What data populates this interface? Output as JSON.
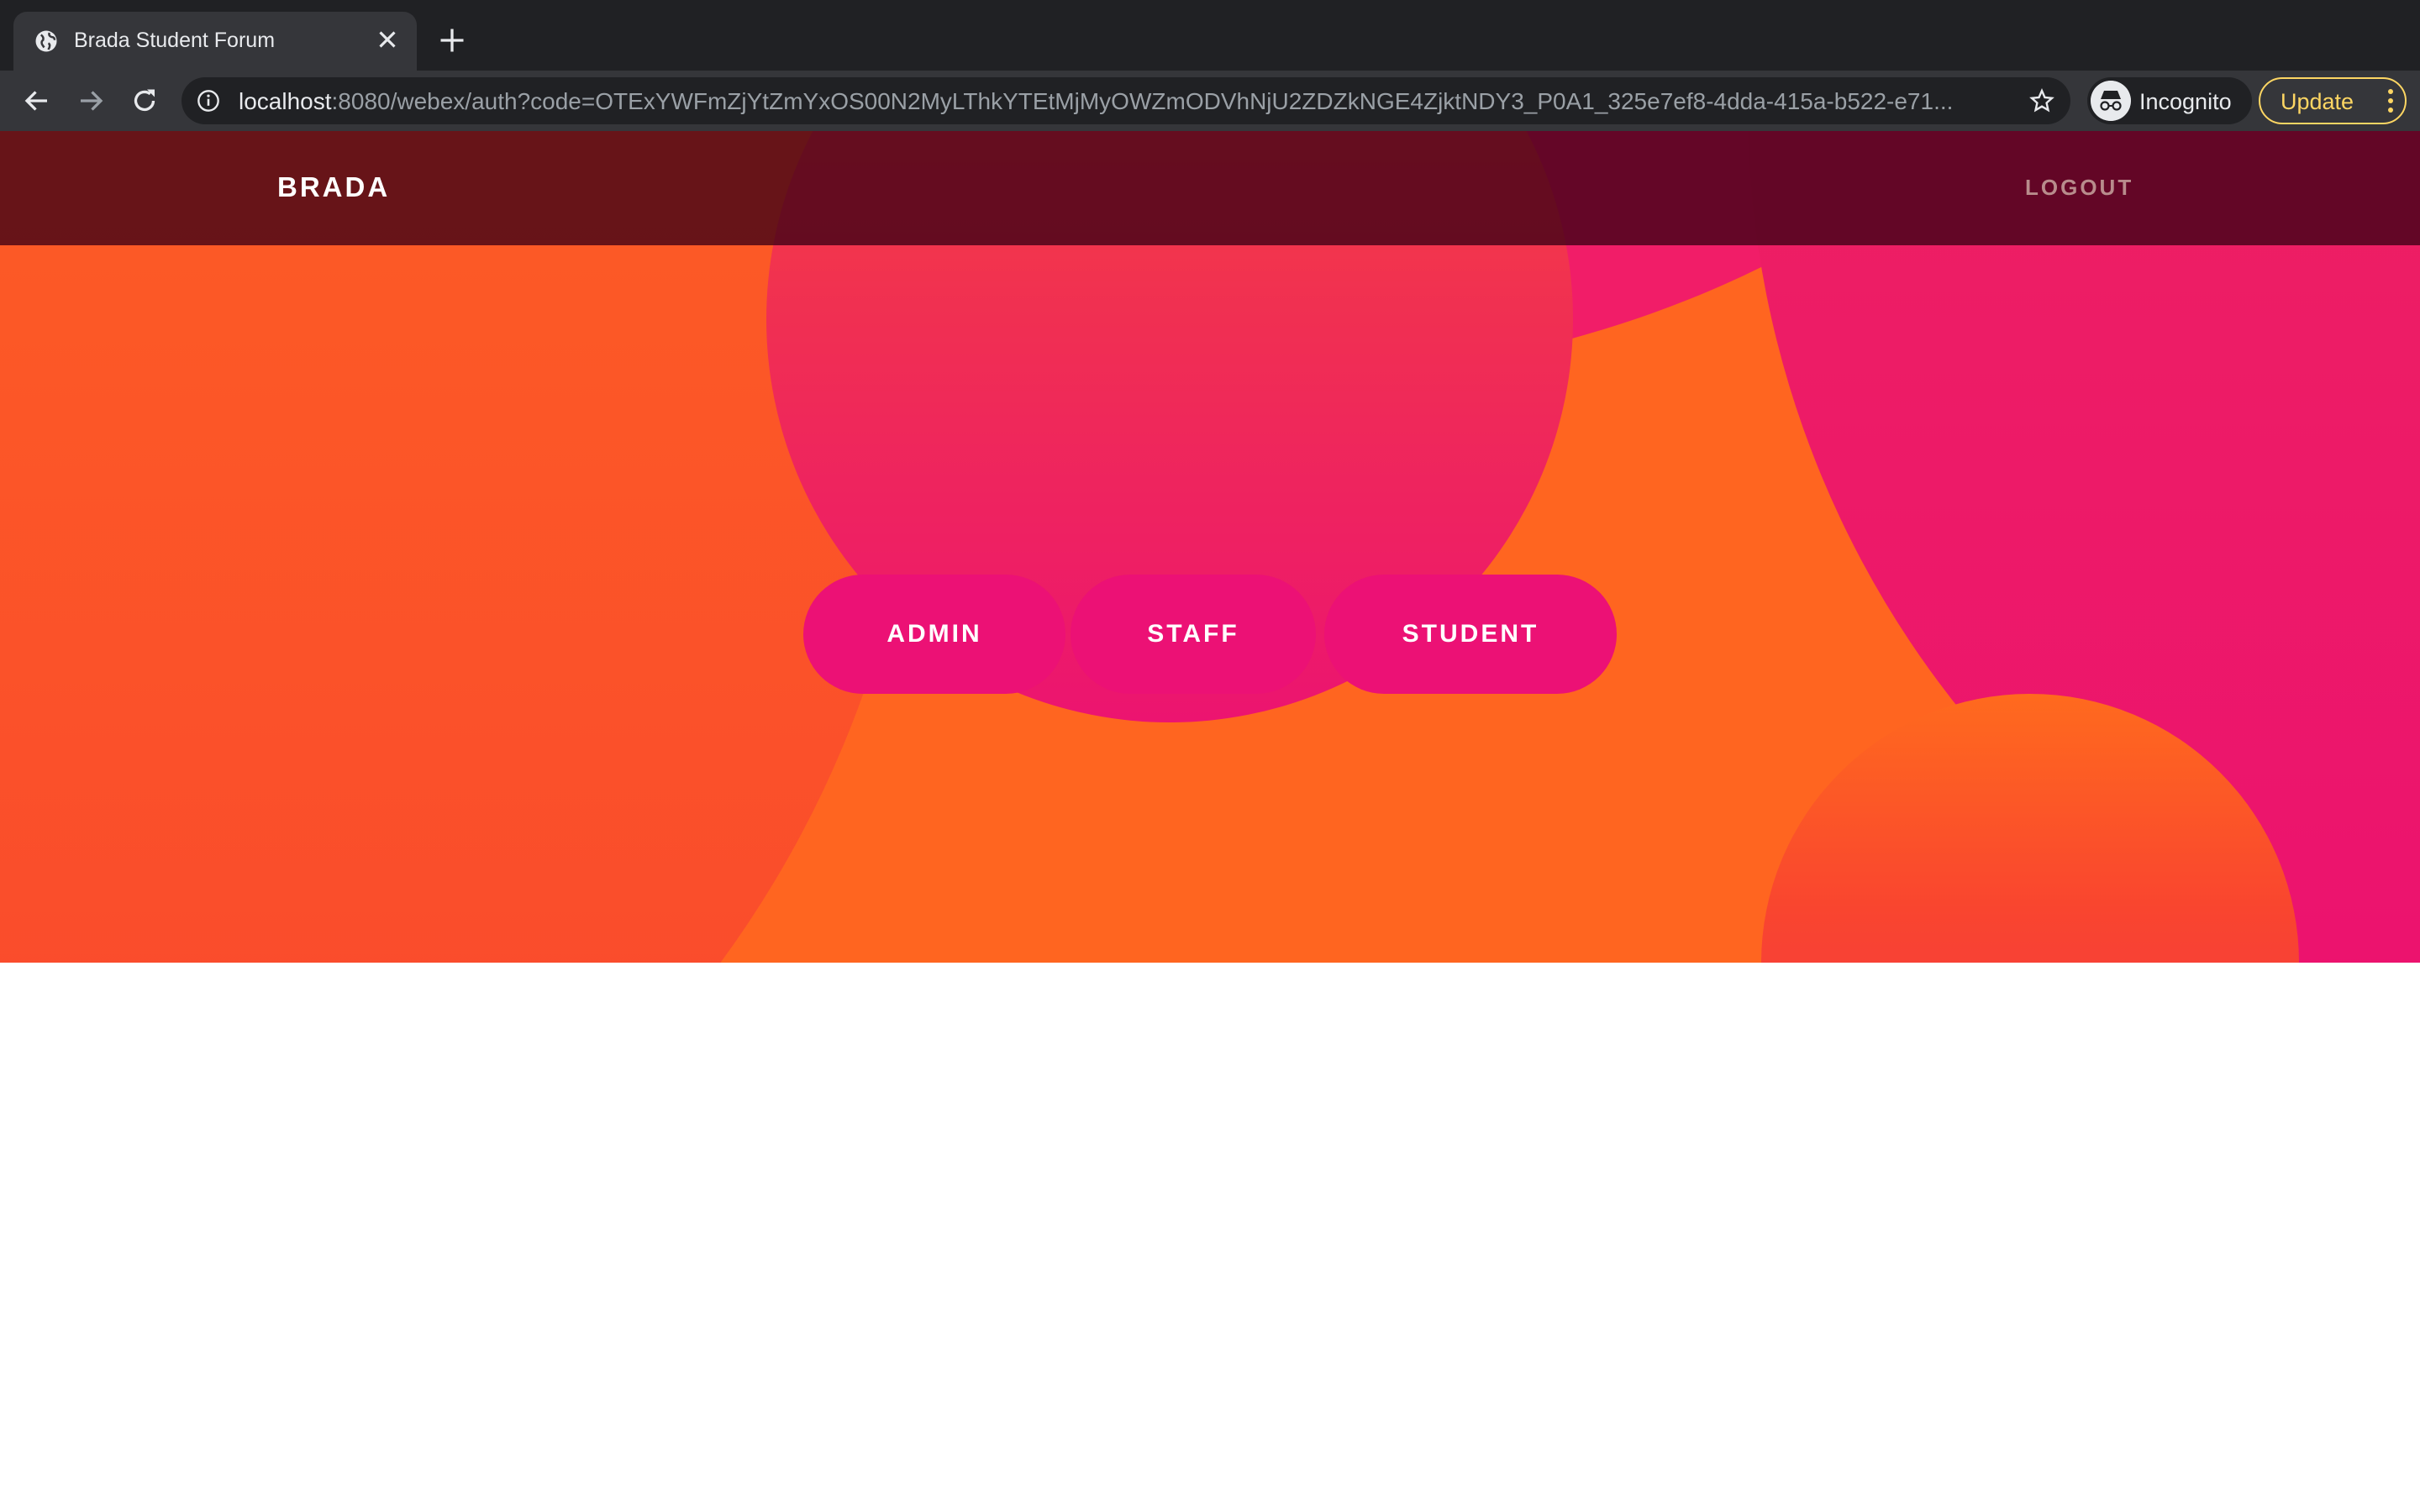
{
  "browser": {
    "tab_title": "Brada Student Forum",
    "url_host": "localhost",
    "url_rest": ":8080/webex/auth?code=OTExYWFmZjYtZmYxOS00N2MyLThkYTEtMjMyOWZmODVhNjU2ZDZkNGE4ZjktNDY3_P0A1_325e7ef8-4dda-415a-b522-e71...",
    "profile_label": "Incognito",
    "update_label": "Update"
  },
  "nav": {
    "brand": "BRADA",
    "logout": "LOGOUT"
  },
  "roles": {
    "admin": "ADMIN",
    "staff": "STAFF",
    "student": "STUDENT"
  },
  "colors": {
    "primary_pink": "#ec1175",
    "orange": "#ff6520",
    "nav_overlay": "#3c0014"
  },
  "icons": [
    "globe-icon",
    "close-icon",
    "plus-icon",
    "back-icon",
    "forward-icon",
    "reload-icon",
    "info-icon",
    "star-icon",
    "incognito-icon",
    "more-vert-icon"
  ]
}
